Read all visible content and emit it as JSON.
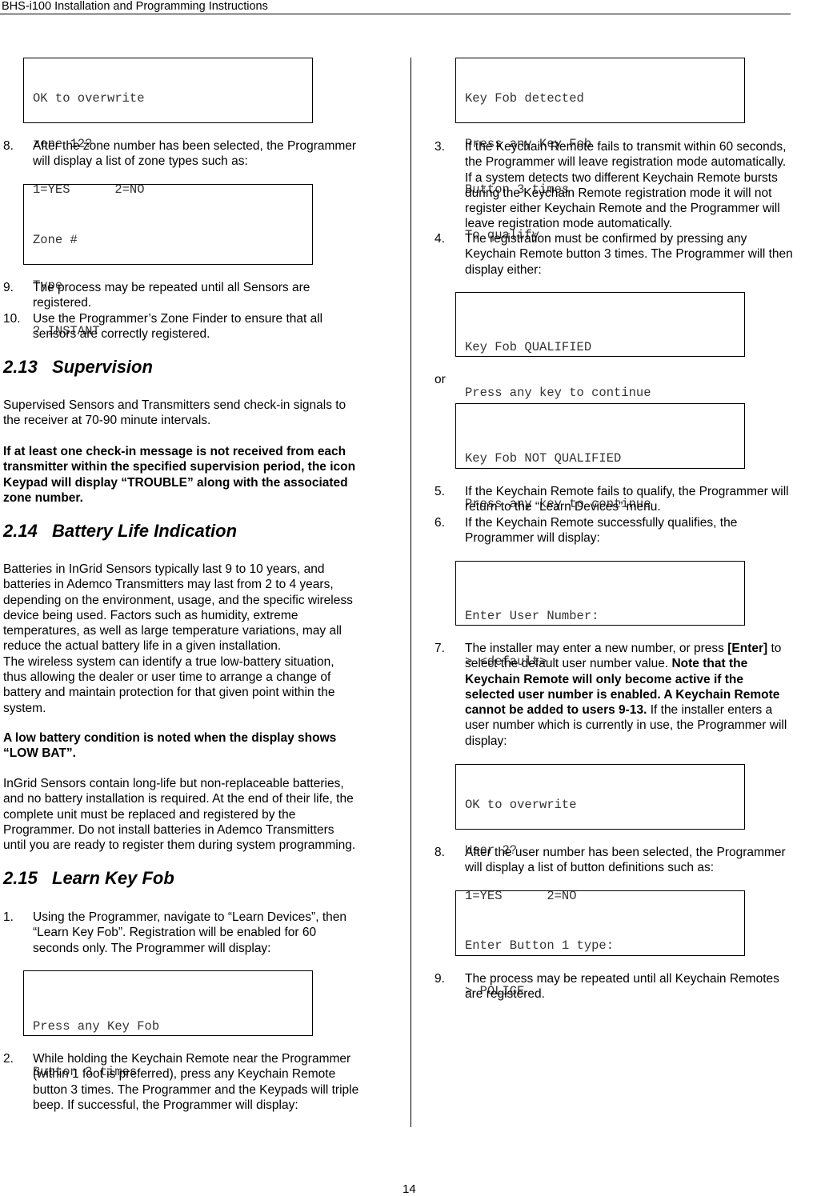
{
  "header": {
    "title": "BHS-i100 Installation and Programming Instructions",
    "page_number": "14"
  },
  "left": {
    "box_overwrite_zone": [
      "OK to overwrite",
      "zone 12?",
      "1=YES      2=NO"
    ],
    "step8": {
      "num": "8.",
      "lines": [
        "After the zone number has been selected, the Programmer",
        "will display a list of zone types such as:"
      ]
    },
    "box_zone_type": [
      "Zone #",
      "Type",
      "? INSTANT"
    ],
    "step9": {
      "num": "9.",
      "lines": [
        "The process may be repeated until all Sensors are",
        "registered."
      ]
    },
    "step10": {
      "num": "10.",
      "lines": [
        "Use the Programmer’s Zone Finder to ensure that all",
        "sensors are correctly registered."
      ]
    },
    "sec213": {
      "number": "2.13",
      "title": "Supervision"
    },
    "sup_para": [
      "Supervised Sensors and Transmitters send check-in signals to",
      "the receiver at 70-90 minute intervals."
    ],
    "sup_bold": [
      "If at least one check-in message is not received from each",
      "transmitter within the specified supervision period, the icon",
      "Keypad will display “TROUBLE” along with the associated",
      "zone number."
    ],
    "sec214": {
      "number": "2.14",
      "title": "Battery Life Indication"
    },
    "bat_para1": [
      "Batteries in InGrid Sensors typically last 9 to 10 years, and",
      "batteries in Ademco Transmitters may last from 2 to 4 years,",
      "depending on the environment, usage, and the specific wireless",
      "device being used. Factors such as humidity, extreme",
      "temperatures, as well as large temperature variations, may all",
      "reduce the actual battery life in a given installation.",
      "The wireless system can identify a true low-battery situation,",
      "thus allowing the dealer or user time to arrange a change of",
      "battery and maintain protection for that given point within the",
      "system."
    ],
    "bat_bold": [
      "A low battery condition is noted when the display shows",
      "“LOW BAT”."
    ],
    "bat_para2": [
      "InGrid Sensors contain long-life but non-replaceable batteries,",
      "and no battery installation is required. At the end of their life, the",
      "complete unit must be replaced and registered by the",
      "Programmer. Do not install batteries in Ademco Transmitters",
      "until you are ready to register them during system programming."
    ],
    "sec215": {
      "number": "2.15",
      "title": "Learn Key Fob"
    },
    "step1": {
      "num": "1.",
      "lines": [
        "Using the Programmer, navigate to “Learn Devices”, then",
        "“Learn Key Fob”. Registration will be enabled for 60",
        "seconds only. The Programmer will display:"
      ]
    },
    "box_press_fob": [
      "Press any Key Fob",
      "Button 3 times"
    ],
    "step2": {
      "num": "2.",
      "lines": [
        "While holding the Keychain Remote near the Programmer",
        "(within 1 foot is preferred), press any Keychain Remote",
        "button 3 times. The Programmer and the Keypads will triple",
        "beep. If successful, the Programmer will display:"
      ]
    }
  },
  "right": {
    "box_detected": [
      "Key Fob detected",
      "Press any Key Fob",
      "Button 3 times",
      "To qualify"
    ],
    "step3": {
      "num": "3.",
      "lines": [
        "If the Keychain Remote fails to transmit within 60 seconds,",
        "the Programmer will leave registration mode automatically.",
        "If a system detects two different Keychain Remote bursts",
        "during the Keychain Remote registration mode it will not",
        "register either Keychain Remote and the Programmer will",
        "leave registration mode automatically."
      ]
    },
    "step4": {
      "num": "4.",
      "lines": [
        "The registration must be confirmed by pressing any",
        "Keychain Remote button 3 times. The Programmer will then",
        "display either:"
      ]
    },
    "box_qualified": [
      "Key Fob QUALIFIED",
      "Press any key to continue"
    ],
    "or_text": "or",
    "box_not_qualified": [
      "Key Fob NOT QUALIFIED",
      "Press any key to continue"
    ],
    "step5": {
      "num": "5.",
      "lines": [
        "If the Keychain Remote fails to qualify, the Programmer will",
        "return to the “Learn Devices” menu."
      ]
    },
    "step6": {
      "num": "6.",
      "lines": [
        "If the Keychain Remote successfully qualifies, the",
        "Programmer will display:"
      ]
    },
    "box_user_number": [
      "Enter User Number:",
      "> <default>"
    ],
    "step7": {
      "num": "7.",
      "l1a": "The installer may enter a new number, or press ",
      "l1b": "[Enter]",
      "l1c": " to",
      "l2a": "select the default user number value. ",
      "l2b": "Note that the",
      "l3": "Keychain Remote will only become active if the",
      "l4": "selected user number is enabled. A Keychain Remote",
      "l5a": "cannot be added to users 9-13.",
      "l5b": " If the installer enters a",
      "l6": "user number which is currently in use, the Programmer will",
      "l7": "display:"
    },
    "box_overwrite_user": [
      "OK to overwrite",
      "User 2?",
      "1=YES      2=NO"
    ],
    "step8": {
      "num": "8.",
      "lines": [
        "After the user number has been selected, the Programmer",
        "will display a list of button definitions such as:"
      ]
    },
    "box_button_type": [
      "Enter Button 1 type:",
      "> POLICE"
    ],
    "step9": {
      "num": "9.",
      "lines": [
        "The process may be repeated until all Keychain Remotes",
        "are registered."
      ]
    }
  }
}
